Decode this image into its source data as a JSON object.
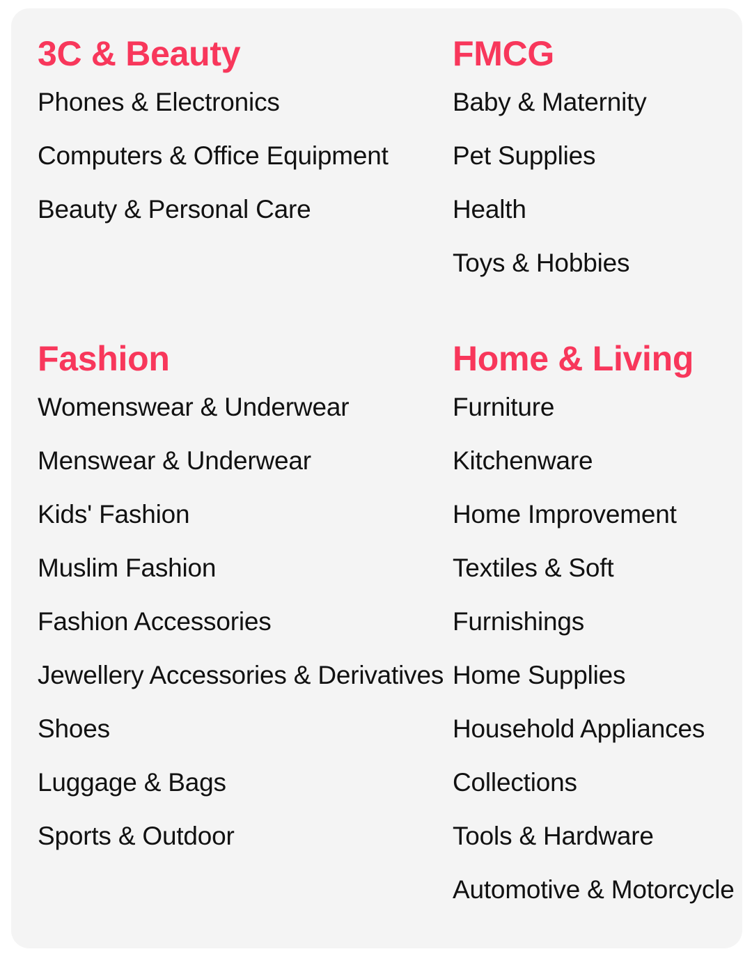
{
  "theme": {
    "accent_color": "#f8375b",
    "text_color": "#111111",
    "card_background": "#f4f4f4",
    "page_background": "#ffffff"
  },
  "groups": [
    {
      "title": "3C & Beauty",
      "position": "top-left",
      "items": [
        "Phones & Electronics",
        "Computers & Office Equipment",
        "Beauty & Personal Care"
      ]
    },
    {
      "title": "FMCG",
      "position": "top-right",
      "items": [
        "Baby & Maternity",
        "Pet Supplies",
        "Health",
        "Toys & Hobbies"
      ]
    },
    {
      "title": "Fashion",
      "position": "bottom-left",
      "items": [
        "Womenswear & Underwear",
        "Menswear & Underwear",
        "Kids' Fashion",
        "Muslim Fashion",
        "Fashion Accessories",
        "Jewellery Accessories & Derivatives",
        "Shoes",
        "Luggage & Bags",
        "Sports & Outdoor"
      ]
    },
    {
      "title": "Home & Living",
      "position": "bottom-right",
      "items": [
        "Furniture",
        "Kitchenware",
        "Home Improvement",
        "Textiles & Soft",
        "Furnishings",
        "Home Supplies",
        "Household Appliances",
        "Collections",
        "Tools & Hardware",
        "Automotive & Motorcycle"
      ]
    }
  ]
}
